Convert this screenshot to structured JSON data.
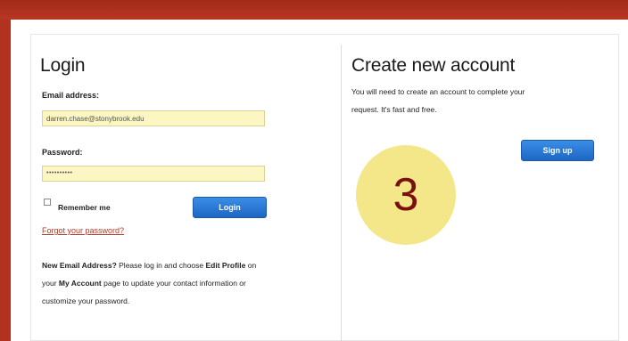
{
  "login": {
    "title": "Login",
    "email_label": "Email address:",
    "email_value": "darren.chase@stonybrook.edu",
    "password_label": "Password:",
    "password_value": "••••••••••",
    "remember_label": "Remember me",
    "remember_checked": false,
    "login_button": "Login",
    "forgot_link": "Forgot your password?",
    "note": {
      "p1": "New Email Address?",
      "p2": " Please log in and choose ",
      "p3": "Edit Profile",
      "p4": " on",
      "p5": "your ",
      "p6": "My Account",
      "p7": " page to update your contact information or",
      "p8": "customize your password."
    }
  },
  "create": {
    "title": "Create new account",
    "text_line1": "You will need to create an account to complete your",
    "text_line2": "request. It's fast and free.",
    "signup_button": "Sign up"
  },
  "callout": {
    "number": "3"
  },
  "colors": {
    "background": "#b3321f",
    "field_fill": "#fbf6c2",
    "button": "#1e66c4",
    "callout": "#f3e78a",
    "callout_text": "#7a0f0f"
  }
}
